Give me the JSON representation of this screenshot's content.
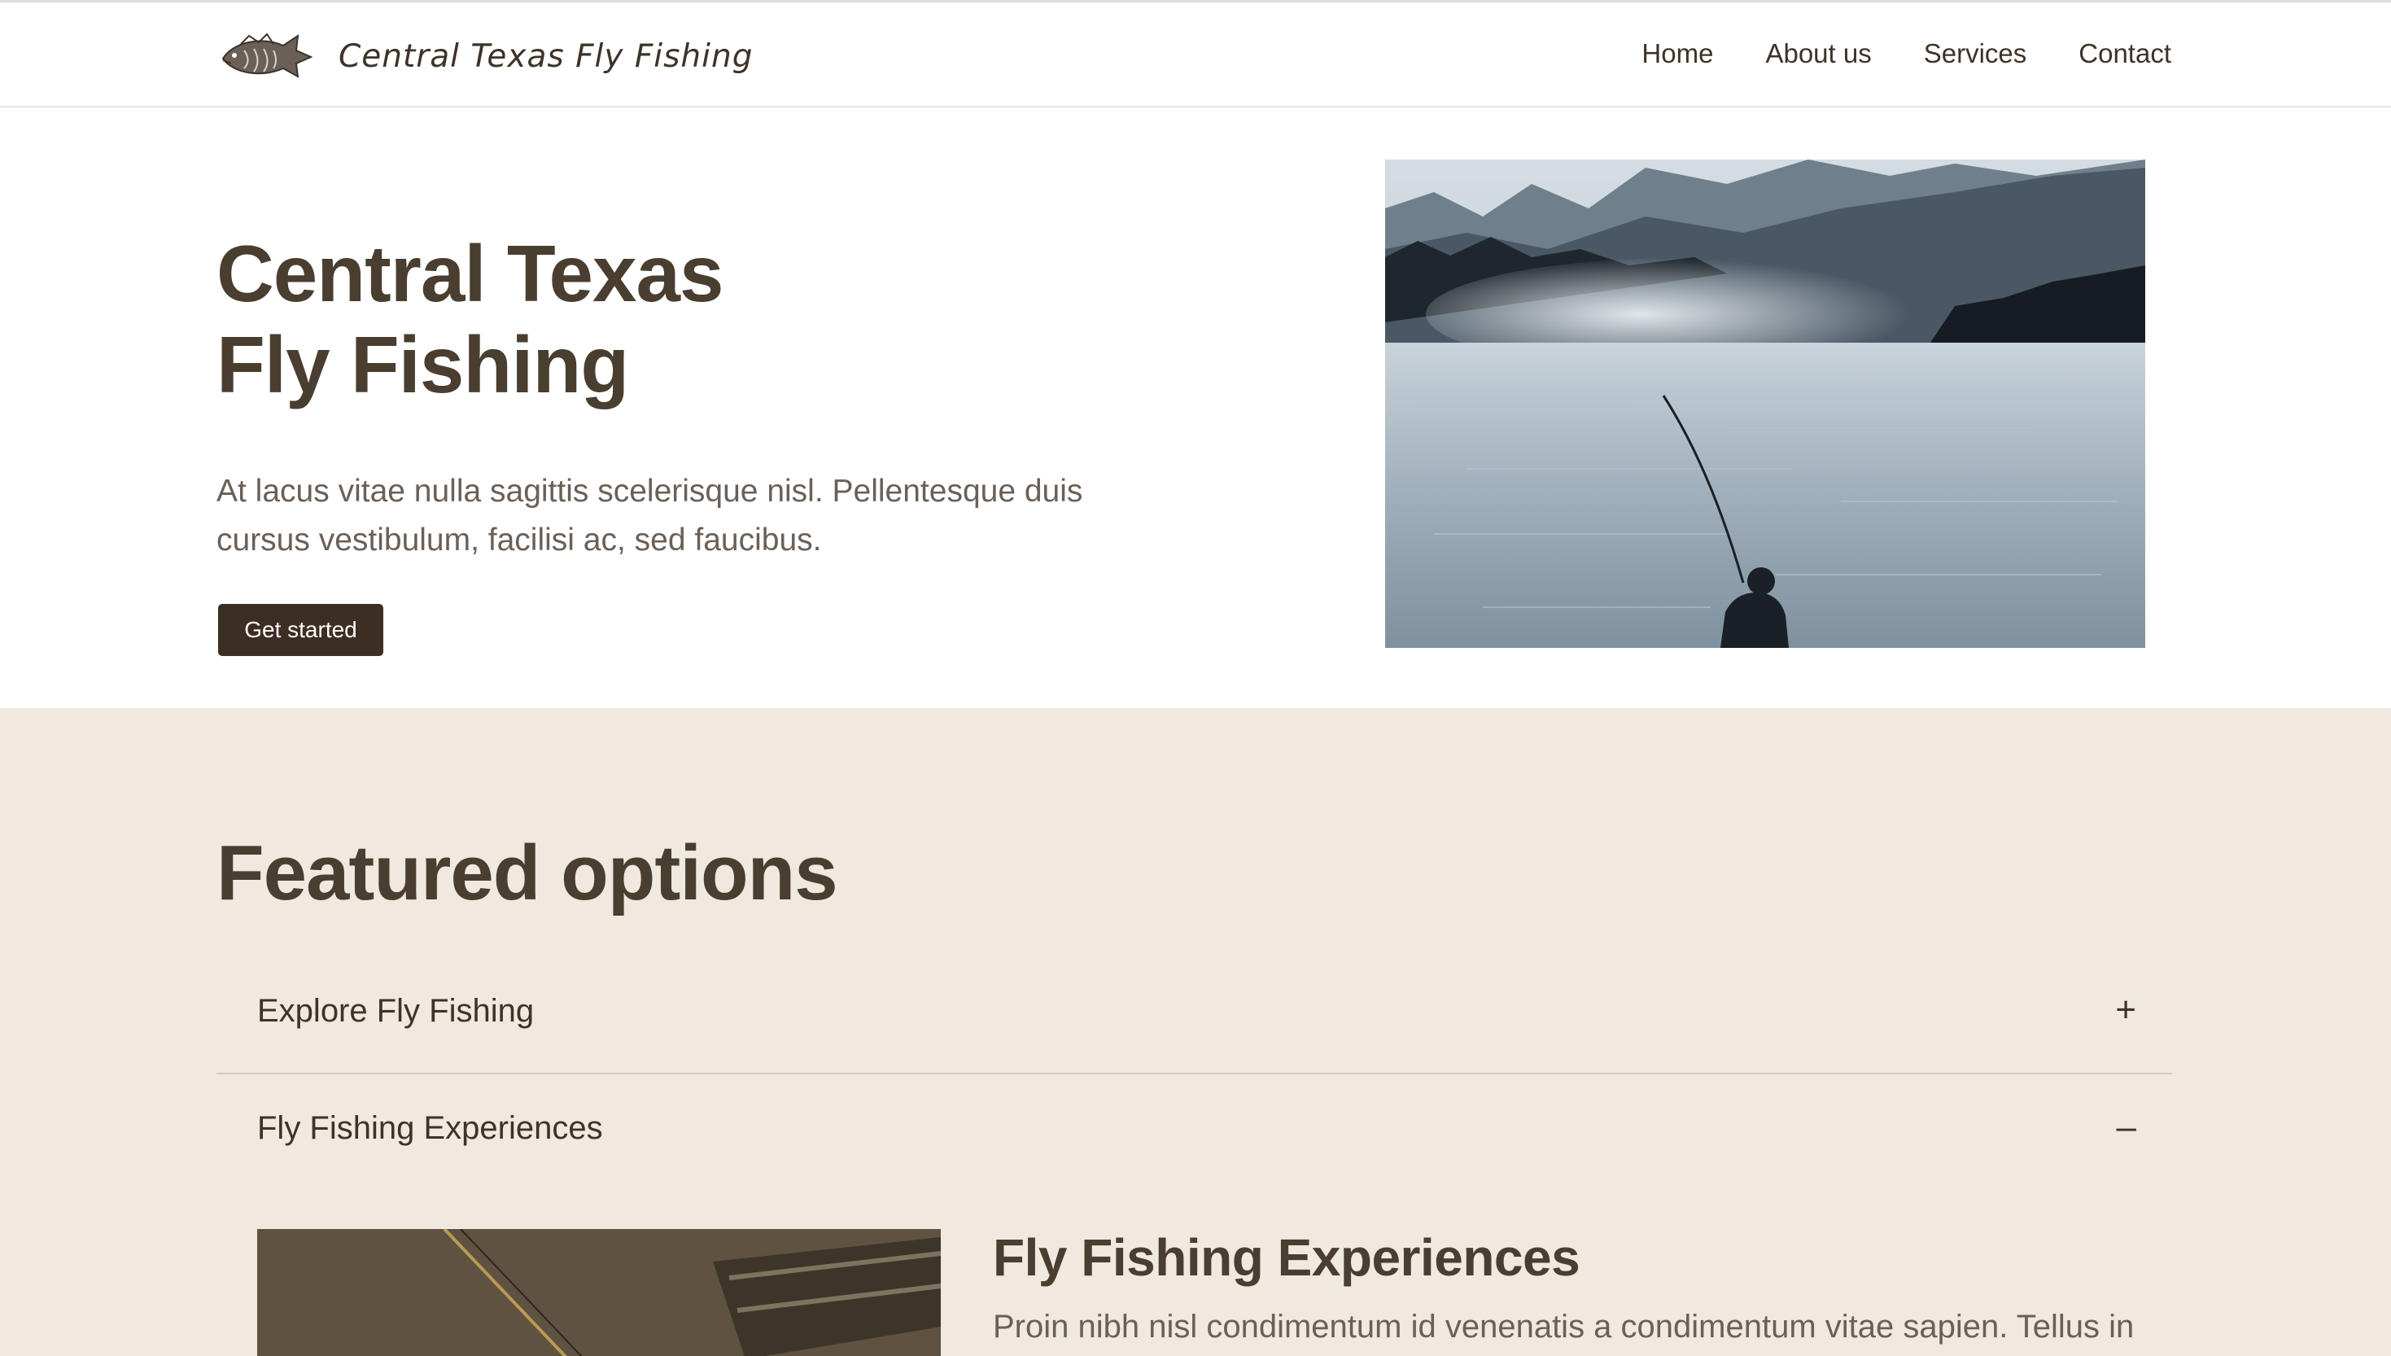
{
  "brand": {
    "name": "Central Texas Fly Fishing",
    "logo_icon": "fish-icon"
  },
  "nav": [
    {
      "label": "Home"
    },
    {
      "label": "About us"
    },
    {
      "label": "Services"
    },
    {
      "label": "Contact"
    }
  ],
  "hero": {
    "title_line1": "Central Texas",
    "title_line2": "Fly Fishing",
    "text": "At lacus vitae nulla sagittis scelerisque nisl. Pellentesque duis cursus vestibulum, facilisi ac, sed faucibus.",
    "cta_label": "Get started",
    "image_subject": "angler fishing on misty mountain lake"
  },
  "featured": {
    "title": "Featured options",
    "items": [
      {
        "label": "Explore Fly Fishing",
        "icon": "+",
        "icon_name": "plus-icon",
        "expanded": false
      },
      {
        "label": "Fly Fishing Experiences",
        "icon": "–",
        "icon_name": "minus-icon",
        "expanded": true
      }
    ],
    "panel": {
      "title": "Fly Fishing Experiences",
      "text": "Proin nibh nisl condimentum id venenatis a condimentum vitae sapien. Tellus in"
    }
  },
  "colors": {
    "accent_dark": "#3d2e24",
    "heading": "#4a3e30",
    "body_text": "#6a6058",
    "featured_bg": "#efe9df"
  }
}
